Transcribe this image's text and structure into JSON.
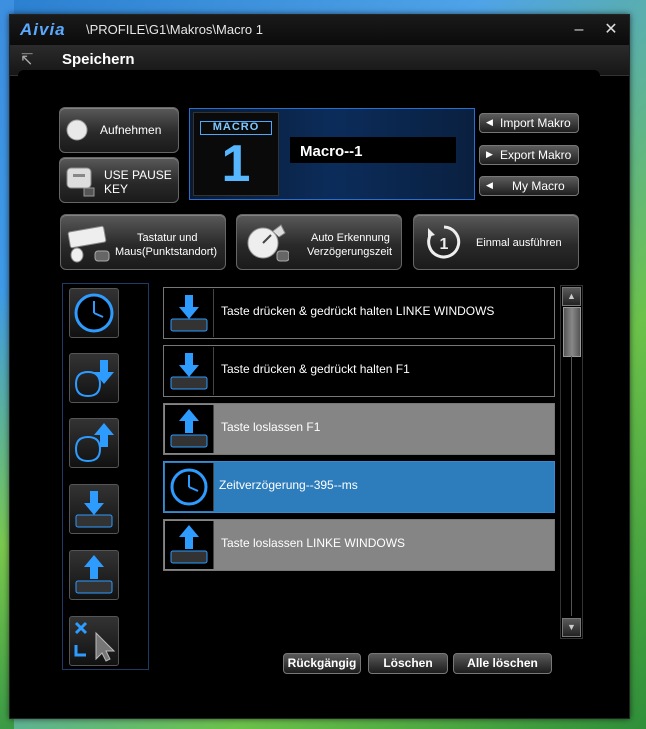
{
  "window": {
    "logo": "Aivia",
    "path": "\\PROFILE\\G1\\Makros\\Macro 1"
  },
  "header": {
    "title": "Speichern"
  },
  "controls": {
    "record_label": "Aufnehmen",
    "use_pause_line1": "USE PAUSE",
    "use_pause_line2": "KEY",
    "keyboard_mouse_line1": "Tastatur und",
    "keyboard_mouse_line2": "Maus(Punktstandort)",
    "auto_detect_line1": "Auto Erkennung",
    "auto_detect_line2": "Verzögerungszeit",
    "run_once_label": "Einmal ausführen"
  },
  "macro": {
    "badge": "MACRO",
    "number": "1",
    "name": "Macro--1"
  },
  "side_buttons": {
    "import": "Import Makro",
    "export": "Export Makro",
    "my_macro": "My Macro"
  },
  "actions": [
    {
      "text": "Taste drücken & gedrückt halten LINKE WINDOWS",
      "icon": "key-down-icon",
      "state": "dark"
    },
    {
      "text": "Taste drücken & gedrückt halten F1",
      "icon": "key-down-icon",
      "state": "dark"
    },
    {
      "text": "Taste loslassen F1",
      "icon": "key-up-icon",
      "state": "gray"
    },
    {
      "text": "Zeitverzögerung--395--ms",
      "icon": "clock-icon",
      "state": "selected"
    },
    {
      "text": "Taste loslassen LINKE WINDOWS",
      "icon": "key-up-icon",
      "state": "gray"
    }
  ],
  "bottom": {
    "undo": "Rückgängig",
    "delete": "Löschen",
    "delete_all": "Alle löschen"
  },
  "colors": {
    "accent": "#2d7dbd",
    "macro_glow": "#56b7ff",
    "gray_row": "#858585"
  }
}
